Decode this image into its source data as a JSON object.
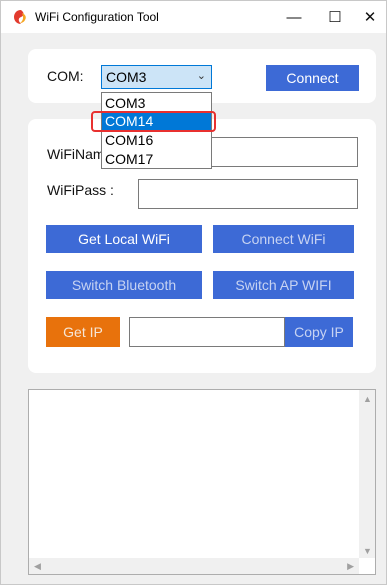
{
  "window": {
    "title": "WiFi Configuration Tool",
    "minimize_glyph": "—",
    "maximize_glyph": "☐",
    "close_glyph": "✕",
    "app_icon": "app-logo-icon"
  },
  "com": {
    "label": "COM:",
    "selected": "COM3",
    "options": [
      "COM3",
      "COM14",
      "COM16",
      "COM17"
    ],
    "highlighted_option": "COM14",
    "connect_label": "Connect"
  },
  "wifi": {
    "name_label": "WiFiNam",
    "pass_label": "WiFiPass :",
    "name_value": "",
    "pass_value": ""
  },
  "actions": {
    "get_local_wifi": "Get Local WiFi",
    "connect_wifi": "Connect WiFi",
    "switch_bluetooth": "Switch Bluetooth",
    "switch_ap_wifi": "Switch AP WIFI",
    "get_ip": "Get IP",
    "ip_value": "",
    "copy_ip": "Copy IP"
  },
  "log": {
    "content": ""
  },
  "colors": {
    "primary_button": "#3d6ad6",
    "get_ip_button": "#e8720c",
    "dropdown_selection": "#0078d7",
    "callout_border": "#e8302f"
  }
}
